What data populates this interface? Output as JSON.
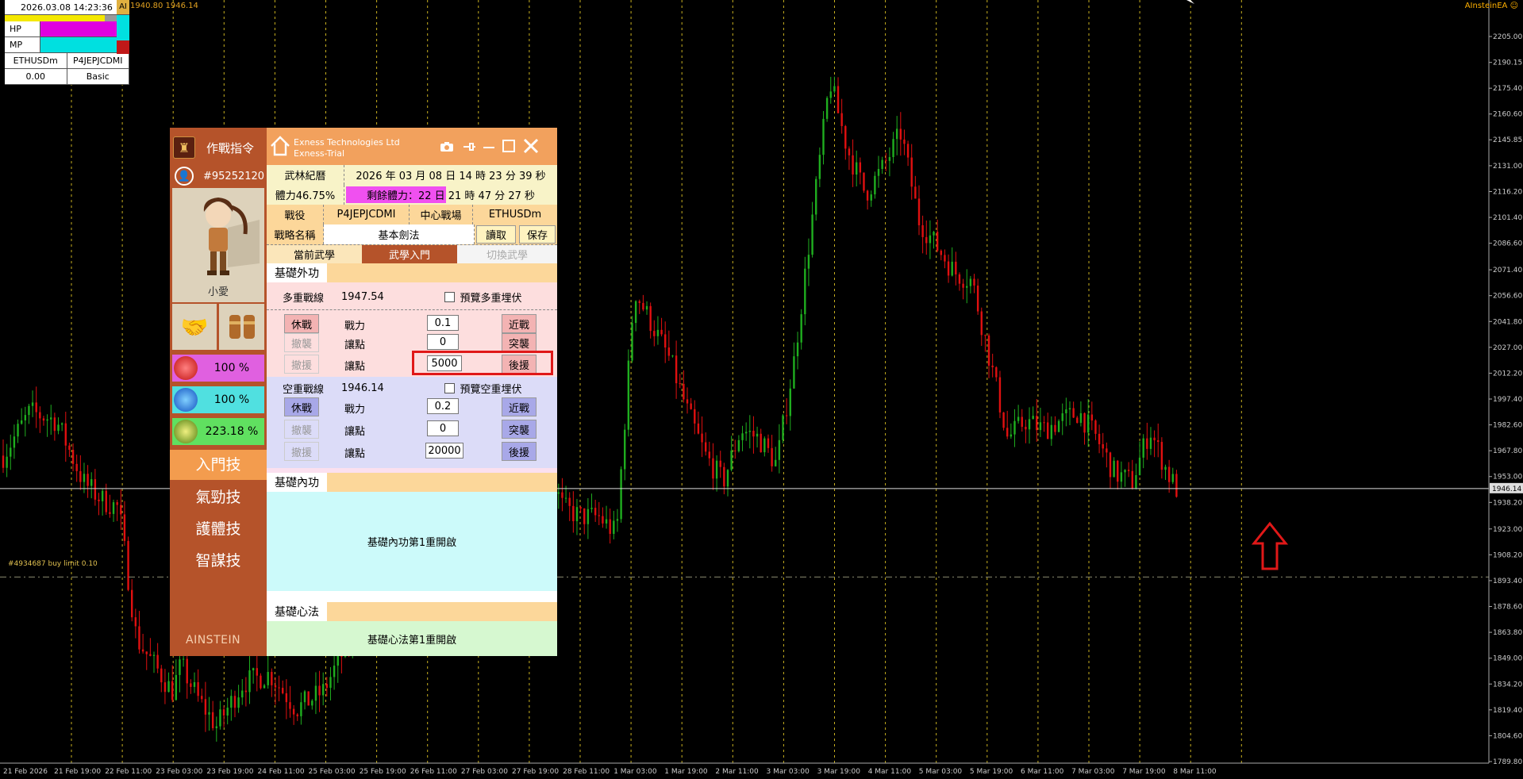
{
  "topleft": {
    "datetime": "2026.03.08 14:23:36",
    "hp_label": "HP",
    "mp_label": "MP",
    "symbol": "ETHUSDm",
    "account_code": "P4JEPJCDMI",
    "value": "0.00",
    "mode": "Basic",
    "hp_fraction": 1.0,
    "mp_fraction": 1.0
  },
  "chart_top": {
    "prefix": "AI",
    "prices": "1940.80 1946.14",
    "ea_name": "AInsteinEA ☺"
  },
  "order_line_label": "#4934687 buy limit 0.10",
  "current_price_tag": "1946.14",
  "chart_data": {
    "type": "candlestick",
    "price_axis": [
      "2205.00",
      "2190.15",
      "2175.40",
      "2160.60",
      "2145.85",
      "2131.00",
      "2116.20",
      "2101.40",
      "2086.60",
      "2071.40",
      "2056.60",
      "2041.80",
      "2027.00",
      "2012.20",
      "1997.40",
      "1982.60",
      "1967.80",
      "1953.00",
      "1938.20",
      "1923.00",
      "1908.20",
      "1893.40",
      "1878.60",
      "1863.80",
      "1849.00",
      "1834.20",
      "1819.40",
      "1804.60",
      "1789.80"
    ],
    "time_axis": [
      "21 Feb 2026",
      "21 Feb 19:00",
      "22 Feb 11:00",
      "23 Feb 03:00",
      "23 Feb 19:00",
      "24 Feb 11:00",
      "25 Feb 03:00",
      "25 Feb 19:00",
      "26 Feb 11:00",
      "27 Feb 03:00",
      "27 Feb 19:00",
      "28 Feb 11:00",
      "1 Mar 03:00",
      "1 Mar 19:00",
      "2 Mar 11:00",
      "3 Mar 03:00",
      "3 Mar 19:00",
      "4 Mar 11:00",
      "5 Mar 03:00",
      "5 Mar 19:00",
      "6 Mar 11:00",
      "7 Mar 03:00",
      "7 Mar 19:00",
      "8 Mar 11:00"
    ],
    "ylim": [
      1789.8,
      2210
    ],
    "current_price": 1946.14,
    "buy_limit": 1895.5,
    "path": [
      [
        0,
        1965
      ],
      [
        3,
        1990
      ],
      [
        6,
        1985
      ],
      [
        9,
        1950
      ],
      [
        11,
        1940
      ],
      [
        13,
        1935
      ],
      [
        15,
        1860
      ],
      [
        17,
        1845
      ],
      [
        19,
        1830
      ],
      [
        20,
        1845
      ],
      [
        22,
        1825
      ],
      [
        24,
        1810
      ],
      [
        27,
        1835
      ],
      [
        30,
        1840
      ],
      [
        33,
        1820
      ],
      [
        36,
        1830
      ],
      [
        38,
        1850
      ],
      [
        40,
        1870
      ],
      [
        43,
        1860
      ],
      [
        45,
        1865
      ],
      [
        47,
        1880
      ],
      [
        49,
        1900
      ],
      [
        51,
        1935
      ],
      [
        53,
        1960
      ],
      [
        55,
        2000
      ],
      [
        57,
        1990
      ],
      [
        59,
        1975
      ],
      [
        61,
        1960
      ],
      [
        63,
        1935
      ],
      [
        65,
        1930
      ],
      [
        67,
        1930
      ],
      [
        69,
        1920
      ],
      [
        71,
        2060
      ],
      [
        73,
        2040
      ],
      [
        75,
        2020
      ],
      [
        77,
        1990
      ],
      [
        79,
        1965
      ],
      [
        81,
        1950
      ],
      [
        83,
        1980
      ],
      [
        85,
        1975
      ],
      [
        87,
        1960
      ],
      [
        89,
        2020
      ],
      [
        91,
        2100
      ],
      [
        93,
        2180
      ],
      [
        95,
        2140
      ],
      [
        97,
        2115
      ],
      [
        99,
        2130
      ],
      [
        101,
        2150
      ],
      [
        103,
        2100
      ],
      [
        105,
        2085
      ],
      [
        107,
        2070
      ],
      [
        109,
        2065
      ],
      [
        111,
        2020
      ],
      [
        113,
        1975
      ],
      [
        115,
        1985
      ],
      [
        117,
        1980
      ],
      [
        119,
        1985
      ],
      [
        121,
        1990
      ],
      [
        123,
        1975
      ],
      [
        125,
        1955
      ],
      [
        127,
        1950
      ],
      [
        129,
        1980
      ],
      [
        131,
        1955
      ],
      [
        132,
        1946
      ]
    ]
  },
  "panel": {
    "side": {
      "title": "作戰指令",
      "account_id": "#95252120",
      "char_name": "小愛",
      "stat1": "100 %",
      "stat2": "100 %",
      "stat3": "223.18 %",
      "menu": [
        "入門技",
        "氣勁技",
        "護體技",
        "智謀技"
      ],
      "logo": "AINSTEIN"
    },
    "header": {
      "company": "Exness Technologies Ltd",
      "server": "Exness-Trial"
    },
    "info": {
      "calendar_label": "武林紀曆",
      "datetime": "2026 年 03 月 08 日 14 時 23 分 39 秒",
      "stamina": "體力46.75%",
      "remaining": "剩餘體力：22 日 21 時 47 分 27 秒",
      "remaining_fraction": 0.47,
      "battle_label": "戰役",
      "battle_code": "P4JEPJCDMI",
      "center_label": "中心戰場",
      "symbol": "ETHUSDm",
      "strategy_label": "戰略名稱",
      "strategy_value": "基本劍法",
      "read_btn": "讀取",
      "save_btn": "保存"
    },
    "tabs": [
      "當前武學",
      "武學入門",
      "切換武學"
    ],
    "outer": {
      "title": "基礎外功",
      "long_label": "多重戰線",
      "long_price": "1947.54",
      "long_preview": "預覽多重埋伏",
      "short_label": "空重戰線",
      "short_price": "1946.14",
      "short_preview": "預覽空重埋伏",
      "rest": "休戰",
      "power": "戰力",
      "retreat_attack": "撤襲",
      "retreat_support": "撤援",
      "points": "讓點",
      "near": "近戰",
      "raid": "突襲",
      "support": "後援",
      "long_vals": [
        "0.1",
        "0",
        "5000"
      ],
      "short_vals": [
        "0.2",
        "0",
        "20000"
      ]
    },
    "inner": {
      "title": "基礎內功",
      "message": "基礎內功第1重開啟"
    },
    "heart": {
      "title": "基礎心法",
      "message": "基礎心法第1重開啟"
    }
  }
}
